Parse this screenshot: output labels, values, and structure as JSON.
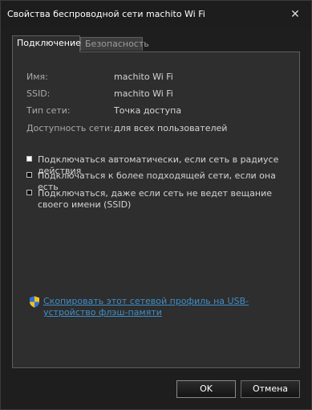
{
  "window": {
    "title": "Свойства беспроводной сети machito Wi Fi",
    "close_glyph": "✕"
  },
  "tabs": [
    {
      "label": "Подключение",
      "active": true
    },
    {
      "label": "Безопасность",
      "active": false
    }
  ],
  "properties": [
    {
      "label": "Имя:",
      "value": "machito Wi Fi"
    },
    {
      "label": "SSID:",
      "value": "machito Wi Fi"
    },
    {
      "label": "Тип сети:",
      "value": "Точка доступа"
    },
    {
      "label": "Доступность сети:",
      "value": "для всех пользователей"
    }
  ],
  "options": [
    {
      "label": "Подключаться автоматически, если сеть в радиусе действия",
      "checked": true
    },
    {
      "label": "Подключаться к более подходящей сети, если она есть",
      "checked": false
    },
    {
      "label": "Подключаться, даже если сеть не ведет вещание своего имени (SSID)",
      "checked": false
    }
  ],
  "usb_link": {
    "icon": "uac-shield-icon",
    "text": "Скопировать этот сетевой профиль на USB-устройство флэш-памяти"
  },
  "buttons": {
    "ok": "OK",
    "cancel": "Отмена"
  },
  "colors": {
    "background": "#2e2e2e",
    "link": "#3f8ec9",
    "text": "#d4d4d4"
  }
}
